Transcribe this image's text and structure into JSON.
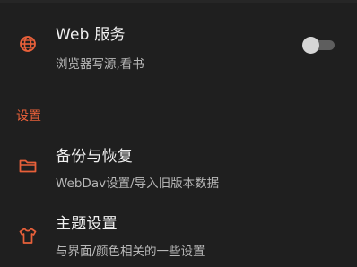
{
  "preferences": {
    "web_service": {
      "title": "Web 服务",
      "summary": "浏览器写源,看书",
      "icon": "globe-icon",
      "switch_on": false
    },
    "settings_section": {
      "header": "设置",
      "items": [
        {
          "title": "备份与恢复",
          "summary": "WebDav设置/导入旧版本数据",
          "icon": "folder-icon"
        },
        {
          "title": "主题设置",
          "summary": "与界面/颜色相关的一些设置",
          "icon": "shirt-icon"
        }
      ]
    }
  },
  "colors": {
    "accent": "#e8603a",
    "background": "#1f1f1f",
    "title_text": "#f1f1f1",
    "summary_text": "#b8b8b8"
  }
}
